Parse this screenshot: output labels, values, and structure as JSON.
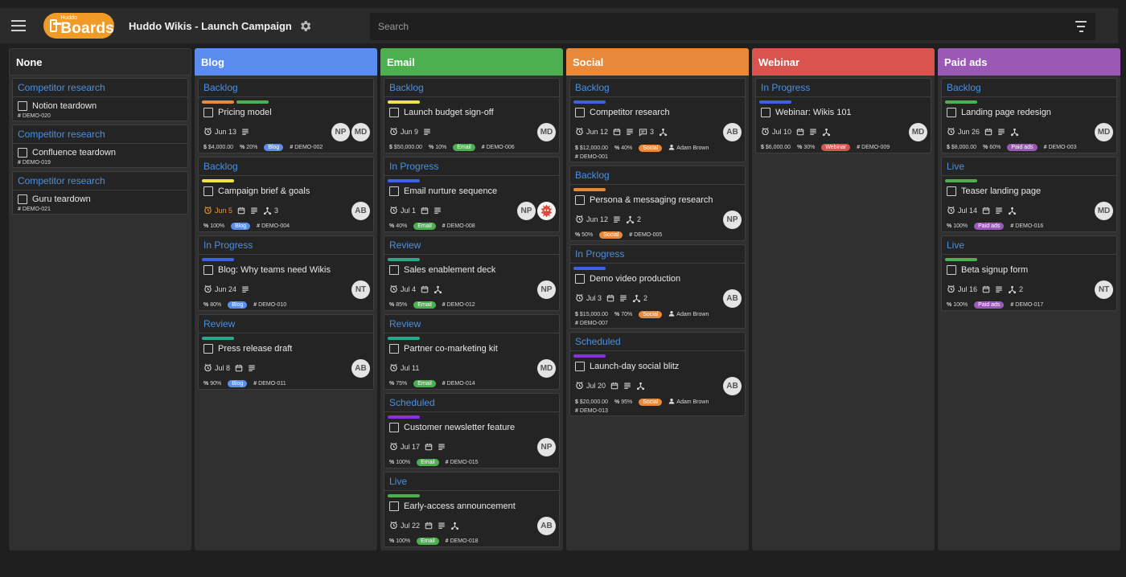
{
  "app": {
    "logo_small": "Huddo",
    "logo_big": "Boards",
    "board_title": "Huddo Wikis - Launch Campaign",
    "search_placeholder": "Search"
  },
  "colors": {
    "blog": "#5b8def",
    "email": "#4caf50",
    "social": "#e8893a",
    "webinar": "#d9534f",
    "paid": "#9b59b6",
    "link": "#4a90e2"
  },
  "columns": [
    {
      "key": "none",
      "title": "None",
      "color": "",
      "cards": [
        {
          "status": "Competitor research",
          "title": "Notion teardown",
          "tags": [
            {
              "kind": "id",
              "text": "DEMO-020"
            }
          ]
        },
        {
          "status": "Competitor research",
          "title": "Confluence teardown",
          "tags": [
            {
              "kind": "id",
              "text": "DEMO-019"
            }
          ]
        },
        {
          "status": "Competitor research",
          "title": "Guru teardown",
          "tags": [
            {
              "kind": "id",
              "text": "DEMO-021"
            }
          ]
        }
      ]
    },
    {
      "key": "blog",
      "title": "Blog",
      "color": "#5b8def",
      "cards": [
        {
          "status": "Backlog",
          "bars": [
            "#e8893a",
            "#4caf50"
          ],
          "title": "Pricing model",
          "date": "Jun 13",
          "icons": [
            "notes"
          ],
          "avatars": [
            "NP",
            "MD"
          ],
          "tags": [
            {
              "kind": "money",
              "text": "$4,000.00"
            },
            {
              "kind": "pct",
              "text": "20%"
            },
            {
              "kind": "pill",
              "text": "Blog",
              "color": "#5b8def"
            },
            {
              "kind": "id",
              "text": "DEMO-002"
            }
          ]
        },
        {
          "status": "Backlog",
          "bars": [
            "#f1e14b"
          ],
          "title": "Campaign brief & goals",
          "date": "Jun 5",
          "overdue": true,
          "icons": [
            "cal",
            "notes",
            "sub"
          ],
          "sub": "3",
          "avatars": [
            "AB"
          ],
          "tags": [
            {
              "kind": "pct",
              "text": "100%"
            },
            {
              "kind": "pill",
              "text": "Blog",
              "color": "#5b8def"
            },
            {
              "kind": "id",
              "text": "DEMO-004"
            }
          ]
        },
        {
          "status": "In Progress",
          "bars": [
            "#3d62e6"
          ],
          "title": "Blog: Why teams need Wikis",
          "date": "Jun 24",
          "icons": [
            "notes"
          ],
          "avatars": [
            "NT"
          ],
          "tags": [
            {
              "kind": "pct",
              "text": "80%"
            },
            {
              "kind": "pill",
              "text": "Blog",
              "color": "#5b8def"
            },
            {
              "kind": "id",
              "text": "DEMO-010"
            }
          ]
        },
        {
          "status": "Review",
          "bars": [
            "#2aa88a"
          ],
          "title": "Press release draft",
          "date": "Jul 8",
          "icons": [
            "cal",
            "notes"
          ],
          "avatars": [
            "AB"
          ],
          "tags": [
            {
              "kind": "pct",
              "text": "90%"
            },
            {
              "kind": "pill",
              "text": "Blog",
              "color": "#5b8def"
            },
            {
              "kind": "id",
              "text": "DEMO-011"
            }
          ]
        }
      ]
    },
    {
      "key": "email",
      "title": "Email",
      "color": "#4caf50",
      "cards": [
        {
          "status": "Backlog",
          "bars": [
            "#f1e14b"
          ],
          "title": "Launch budget sign-off",
          "date": "Jun 9",
          "icons": [
            "notes"
          ],
          "avatars": [
            "MD"
          ],
          "tags": [
            {
              "kind": "money",
              "text": "$50,000.00"
            },
            {
              "kind": "pct",
              "text": "10%"
            },
            {
              "kind": "pill",
              "text": "Email",
              "color": "#4caf50"
            },
            {
              "kind": "id",
              "text": "DEMO-006"
            }
          ]
        },
        {
          "status": "In Progress",
          "bars": [
            "#3d62e6"
          ],
          "title": "Email nurture sequence",
          "date": "Jul 1",
          "icons": [
            "cal",
            "notes"
          ],
          "avatars": [
            "NP",
            "img"
          ],
          "tags": [
            {
              "kind": "pct",
              "text": "40%"
            },
            {
              "kind": "pill",
              "text": "Email",
              "color": "#4caf50"
            },
            {
              "kind": "id",
              "text": "DEMO-008"
            }
          ]
        },
        {
          "status": "Review",
          "bars": [
            "#2aa88a"
          ],
          "title": "Sales enablement deck",
          "date": "Jul 4",
          "icons": [
            "cal",
            "sub"
          ],
          "avatars": [
            "NP"
          ],
          "tags": [
            {
              "kind": "pct",
              "text": "85%"
            },
            {
              "kind": "pill",
              "text": "Email",
              "color": "#4caf50"
            },
            {
              "kind": "id",
              "text": "DEMO-012"
            }
          ]
        },
        {
          "status": "Review",
          "bars": [
            "#2aa88a"
          ],
          "title": "Partner co-marketing kit",
          "date": "Jul 11",
          "icons": [],
          "avatars": [
            "MD"
          ],
          "tags": [
            {
              "kind": "pct",
              "text": "75%"
            },
            {
              "kind": "pill",
              "text": "Email",
              "color": "#4caf50"
            },
            {
              "kind": "id",
              "text": "DEMO-014"
            }
          ]
        },
        {
          "status": "Scheduled",
          "bars": [
            "#8e2de2"
          ],
          "title": "Customer newsletter feature",
          "date": "Jul 17",
          "icons": [
            "cal",
            "notes"
          ],
          "avatars": [
            "NP"
          ],
          "tags": [
            {
              "kind": "pct",
              "text": "100%"
            },
            {
              "kind": "pill",
              "text": "Email",
              "color": "#4caf50"
            },
            {
              "kind": "id",
              "text": "DEMO-015"
            }
          ]
        },
        {
          "status": "Live",
          "bars": [
            "#4caf50"
          ],
          "title": "Early-access announcement",
          "date": "Jul 22",
          "icons": [
            "cal",
            "notes",
            "sub"
          ],
          "avatars": [
            "AB"
          ],
          "tags": [
            {
              "kind": "pct",
              "text": "100%"
            },
            {
              "kind": "pill",
              "text": "Email",
              "color": "#4caf50"
            },
            {
              "kind": "id",
              "text": "DEMO-018"
            }
          ]
        }
      ]
    },
    {
      "key": "social",
      "title": "Social",
      "color": "#e8893a",
      "cards": [
        {
          "status": "Backlog",
          "bars": [
            "#3d62e6"
          ],
          "title": "Competitor research",
          "date": "Jun 12",
          "icons": [
            "cal",
            "notes",
            "comment",
            "sub"
          ],
          "comment": "3",
          "avatars": [
            "AB"
          ],
          "tags": [
            {
              "kind": "money",
              "text": "$12,000.00"
            },
            {
              "kind": "pct",
              "text": "40%"
            },
            {
              "kind": "pill",
              "text": "Social",
              "color": "#e8893a"
            },
            {
              "kind": "person",
              "text": "Adam Brown"
            },
            {
              "kind": "id",
              "text": "DEMO-001"
            }
          ]
        },
        {
          "status": "Backlog",
          "bars": [
            "#e8893a"
          ],
          "title": "Persona & messaging research",
          "date": "Jun 12",
          "icons": [
            "notes",
            "sub"
          ],
          "sub": "2",
          "avatars": [
            "NP"
          ],
          "tags": [
            {
              "kind": "pct",
              "text": "50%"
            },
            {
              "kind": "pill",
              "text": "Social",
              "color": "#e8893a"
            },
            {
              "kind": "id",
              "text": "DEMO-005"
            }
          ]
        },
        {
          "status": "In Progress",
          "bars": [
            "#3d62e6"
          ],
          "title": "Demo video production",
          "date": "Jul 3",
          "icons": [
            "cal",
            "notes",
            "sub"
          ],
          "sub": "2",
          "avatars": [
            "AB"
          ],
          "tags": [
            {
              "kind": "money",
              "text": "$15,000.00"
            },
            {
              "kind": "pct",
              "text": "70%"
            },
            {
              "kind": "pill",
              "text": "Social",
              "color": "#e8893a"
            },
            {
              "kind": "person",
              "text": "Adam Brown"
            },
            {
              "kind": "id",
              "text": "DEMO-007"
            }
          ]
        },
        {
          "status": "Scheduled",
          "bars": [
            "#8e2de2"
          ],
          "title": "Launch-day social blitz",
          "date": "Jul 20",
          "icons": [
            "cal",
            "notes",
            "sub"
          ],
          "avatars": [
            "AB"
          ],
          "tags": [
            {
              "kind": "money",
              "text": "$20,000.00"
            },
            {
              "kind": "pct",
              "text": "95%"
            },
            {
              "kind": "pill",
              "text": "Social",
              "color": "#e8893a"
            },
            {
              "kind": "person",
              "text": "Adam Brown"
            },
            {
              "kind": "id",
              "text": "DEMO-013"
            }
          ]
        }
      ]
    },
    {
      "key": "webinar",
      "title": "Webinar",
      "color": "#d9534f",
      "cards": [
        {
          "status": "In Progress",
          "bars": [
            "#3d62e6"
          ],
          "title": "Webinar: Wikis 101",
          "date": "Jul 10",
          "icons": [
            "cal",
            "notes",
            "sub"
          ],
          "avatars": [
            "MD"
          ],
          "tags": [
            {
              "kind": "money",
              "text": "$6,000.00"
            },
            {
              "kind": "pct",
              "text": "30%"
            },
            {
              "kind": "pill",
              "text": "Webinar",
              "color": "#d9534f"
            },
            {
              "kind": "id",
              "text": "DEMO-009"
            }
          ]
        }
      ]
    },
    {
      "key": "paid",
      "title": "Paid ads",
      "color": "#9b59b6",
      "cards": [
        {
          "status": "Backlog",
          "bars": [
            "#4caf50"
          ],
          "title": "Landing page redesign",
          "date": "Jun 26",
          "icons": [
            "cal",
            "notes",
            "sub"
          ],
          "avatars": [
            "MD"
          ],
          "tags": [
            {
              "kind": "money",
              "text": "$8,000.00"
            },
            {
              "kind": "pct",
              "text": "60%"
            },
            {
              "kind": "pill",
              "text": "Paid ads",
              "color": "#9b59b6"
            },
            {
              "kind": "id",
              "text": "DEMO-003"
            }
          ]
        },
        {
          "status": "Live",
          "bars": [
            "#4caf50"
          ],
          "title": "Teaser landing page",
          "date": "Jul 14",
          "icons": [
            "cal",
            "notes",
            "sub"
          ],
          "avatars": [
            "MD"
          ],
          "tags": [
            {
              "kind": "pct",
              "text": "100%"
            },
            {
              "kind": "pill",
              "text": "Paid ads",
              "color": "#9b59b6"
            },
            {
              "kind": "id",
              "text": "DEMO-016"
            }
          ]
        },
        {
          "status": "Live",
          "bars": [
            "#4caf50"
          ],
          "title": "Beta signup form",
          "date": "Jul 16",
          "icons": [
            "cal",
            "notes",
            "sub"
          ],
          "sub": "2",
          "avatars": [
            "NT"
          ],
          "tags": [
            {
              "kind": "pct",
              "text": "100%"
            },
            {
              "kind": "pill",
              "text": "Paid ads",
              "color": "#9b59b6"
            },
            {
              "kind": "id",
              "text": "DEMO-017"
            }
          ]
        }
      ]
    }
  ]
}
